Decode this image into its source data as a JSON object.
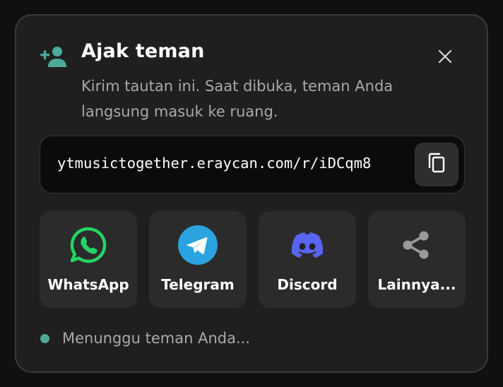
{
  "dialog": {
    "title": "Ajak teman",
    "subtitle": "Kirim tautan ini. Saat dibuka, teman Anda langsung masuk ke ruang.",
    "header_icon": "add-person-icon",
    "close_icon": "close-icon"
  },
  "link": {
    "url": "ytmusictogether.eraycan.com/r/iDCqm8",
    "copy_icon": "copy-icon"
  },
  "share": [
    {
      "label": "WhatsApp",
      "icon": "whatsapp-icon",
      "color": "#25D366"
    },
    {
      "label": "Telegram",
      "icon": "telegram-icon",
      "color": "#2AA3E0"
    },
    {
      "label": "Discord",
      "icon": "discord-icon",
      "color": "#5865F2"
    },
    {
      "label": "Lainnya...",
      "icon": "share-icon",
      "color": "#9a9a9a"
    }
  ],
  "status": {
    "text": "Menunggu teman Anda...",
    "dot_color": "#4EA99A"
  },
  "colors": {
    "accent": "#4EA99A",
    "dialog_bg": "#1F1F1F",
    "tile_bg": "#2B2B2B"
  }
}
